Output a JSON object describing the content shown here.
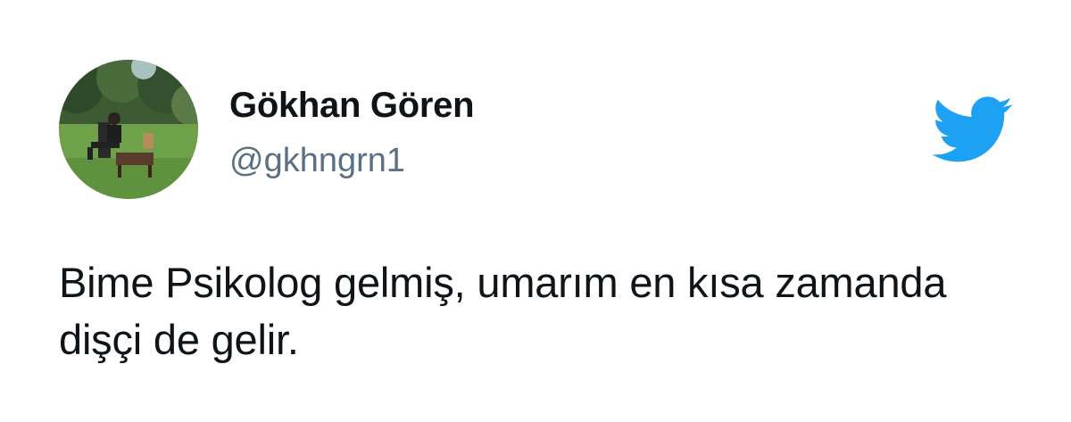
{
  "tweet": {
    "author": {
      "display_name": "Gökhan Gören",
      "handle": "@gkhngrn1",
      "avatar_icon": "profile-photo"
    },
    "text": "Bime Psikolog gelmiş, umarım en kısa zamanda dişçi de gelir.",
    "brand_icon": "twitter-bird-icon",
    "colors": {
      "brand": "#1da1f2",
      "name": "#0f1419",
      "handle": "#5b7083",
      "background": "#ffffff"
    }
  }
}
